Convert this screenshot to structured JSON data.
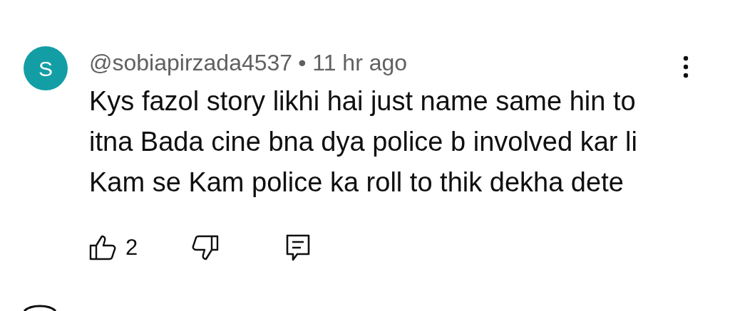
{
  "comment": {
    "avatar_letter": "S",
    "author": "@sobiapirzada4537",
    "time": "• 11 hr ago",
    "lines": [
      "Kys fazol story likhi hai just name same hin to",
      "itna Bada cine bna dya police b involved kar li",
      "Kam se Kam police ka roll to thik dekha dete"
    ],
    "like_count": "2"
  }
}
